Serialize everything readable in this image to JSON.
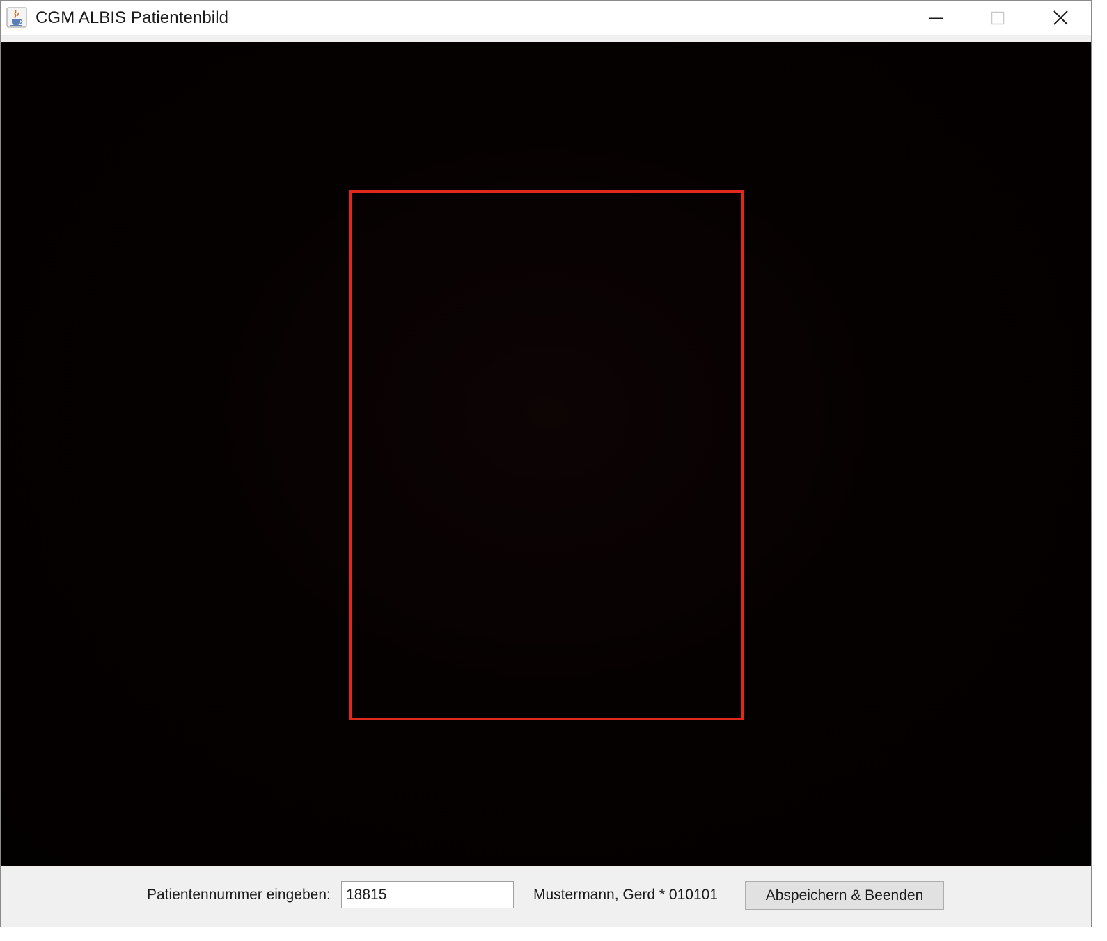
{
  "window": {
    "title": "CGM ALBIS Patientenbild",
    "icon": "java-cup-icon",
    "controls": [
      "minimize-icon",
      "maximize-icon",
      "close-icon"
    ]
  },
  "camera": {
    "guide_color": "#e0281f"
  },
  "footer": {
    "patient_number_label": "Patientennummer eingeben:",
    "patient_number_value": "18815",
    "patient_info": "Mustermann, Gerd * 010101",
    "save_button_label": "Abspeichern & Beenden"
  }
}
